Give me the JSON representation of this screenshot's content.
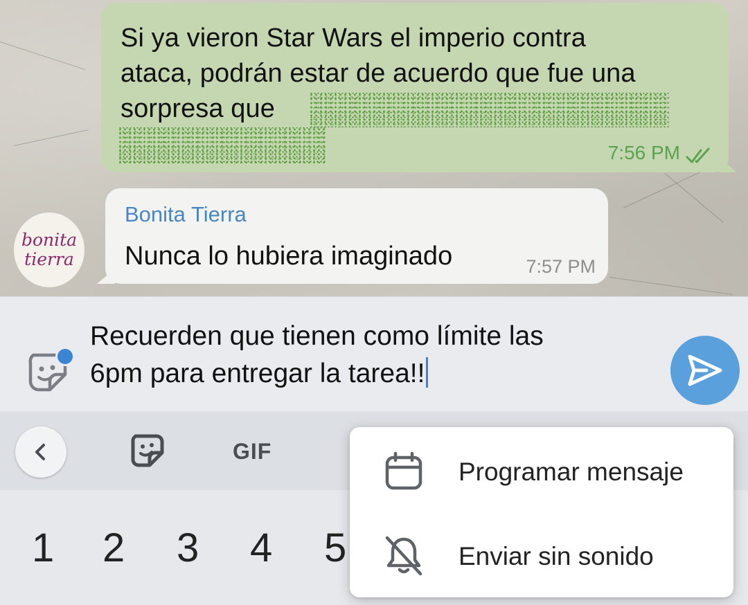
{
  "chat": {
    "outgoing": {
      "text_lines": [
        "Si ya vieron Star Wars el imperio contra",
        "ataca, podrán estar de acuerdo que fue una",
        "sorpresa que"
      ],
      "time": "7:56 PM",
      "status_icon": "double-check-icon"
    },
    "incoming": {
      "avatar_text": [
        "bonita",
        "tierra"
      ],
      "sender": "Bonita Tierra",
      "text": "Nunca lo hubiera imaginado",
      "time": "7:57 PM"
    }
  },
  "composer": {
    "text_lines": [
      "Recuerden que tienen como límite las",
      "6pm para entregar la tarea!!"
    ],
    "sticker_icon": "sticker-icon",
    "send_icon": "send-icon"
  },
  "keyboard_toolbar": {
    "back_icon": "chevron-left-icon",
    "sticker_icon": "sticker-icon",
    "gif_label": "GIF",
    "more_partial": "⋮"
  },
  "keyboard": {
    "number_row": [
      "1",
      "2",
      "3",
      "4",
      "5"
    ]
  },
  "send_options_menu": {
    "items": [
      {
        "label": "Programar mensaje",
        "icon": "calendar-icon"
      },
      {
        "label": "Enviar sin sonido",
        "icon": "bell-off-icon"
      }
    ]
  },
  "colors": {
    "outgoing_bubble": "#c5d7b1",
    "incoming_bubble": "#f3f3f1",
    "accent": "#5aa0dc",
    "sender_name": "#4a86c2",
    "time_out": "#5aa150"
  }
}
